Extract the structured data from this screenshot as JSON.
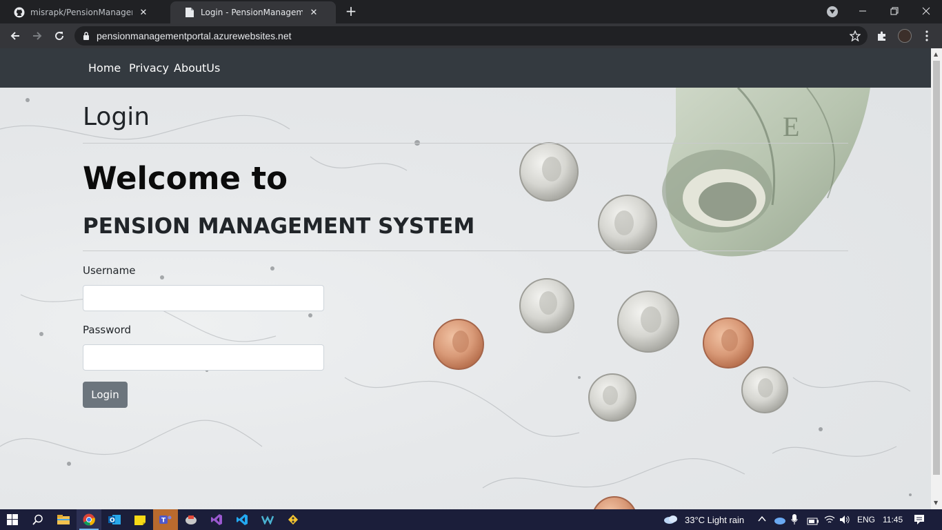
{
  "browser": {
    "tabs": [
      {
        "title": "misrapk/PensionManagement-Po",
        "icon": "github-icon"
      },
      {
        "title": "Login - PensionManagementPort",
        "icon": "page-icon"
      }
    ],
    "url": "pensionmanagementportal.azurewebsites.net"
  },
  "navbar": {
    "links": [
      "Home",
      "Privacy",
      "AboutUs"
    ]
  },
  "page": {
    "heading": "Login",
    "welcome": "Welcome to",
    "system_title": "PENSION MANAGEMENT SYSTEM",
    "form": {
      "username_label": "Username",
      "username_value": "",
      "password_label": "Password",
      "password_value": "",
      "submit_label": "Login"
    }
  },
  "taskbar": {
    "weather": "33°C  Light rain",
    "language": "ENG",
    "time": "11:45"
  },
  "colors": {
    "navbar": "#343a40",
    "button": "#6c757d",
    "taskbar": "#1b1e3a"
  }
}
